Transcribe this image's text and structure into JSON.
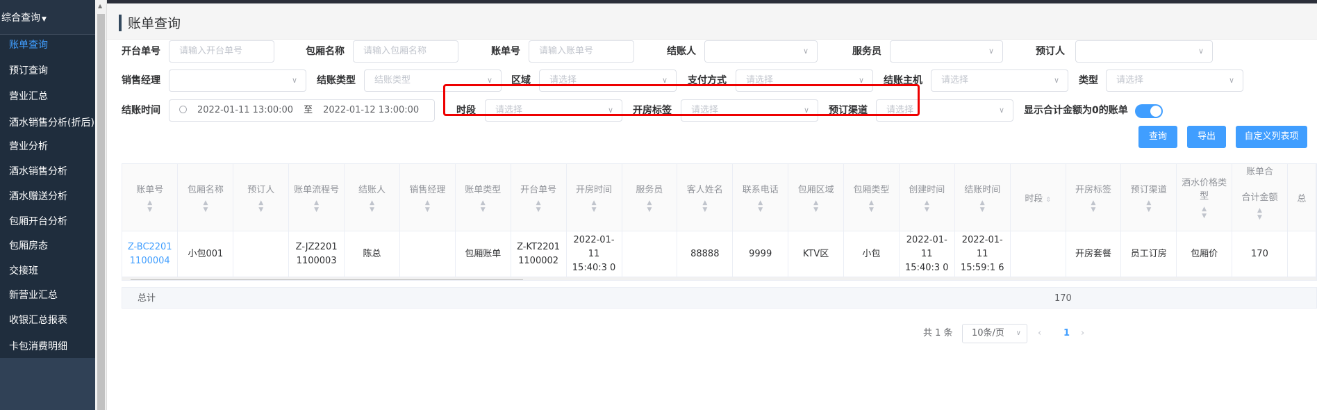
{
  "sidebar": {
    "group_label": "综合查询",
    "items": [
      {
        "label": "账单查询"
      },
      {
        "label": "预订查询"
      },
      {
        "label": "营业汇总"
      },
      {
        "label": "酒水销售分析(折后)"
      },
      {
        "label": "营业分析"
      },
      {
        "label": "酒水销售分析"
      },
      {
        "label": "酒水赠送分析"
      },
      {
        "label": "包厢开台分析"
      },
      {
        "label": "包厢房态"
      },
      {
        "label": "交接班"
      },
      {
        "label": "新营业汇总"
      },
      {
        "label": "收银汇总报表"
      },
      {
        "label": "卡包消费明细"
      }
    ]
  },
  "page": {
    "title": "账单查询"
  },
  "filters": {
    "open_order_no": {
      "label": "开台单号",
      "placeholder": "请输入开台单号"
    },
    "room_name": {
      "label": "包厢名称",
      "placeholder": "请输入包厢名称"
    },
    "bill_no": {
      "label": "账单号",
      "placeholder": "请输入账单号"
    },
    "checkout_person": {
      "label": "结账人",
      "value": ""
    },
    "waiter": {
      "label": "服务员",
      "value": ""
    },
    "booker": {
      "label": "预订人",
      "value": ""
    },
    "sales_manager": {
      "label": "销售经理",
      "value": ""
    },
    "checkout_type": {
      "label": "结账类型",
      "placeholder": "结账类型"
    },
    "area": {
      "label": "区域",
      "placeholder": "请选择"
    },
    "payment_method": {
      "label": "支付方式",
      "placeholder": "请选择"
    },
    "checkout_host": {
      "label": "结账主机",
      "placeholder": "请选择"
    },
    "type": {
      "label": "类型",
      "placeholder": "请选择"
    },
    "checkout_time": {
      "label": "结账时间",
      "start": "2022-01-11 13:00:00",
      "separator": "至",
      "end": "2022-01-12 13:00:00"
    },
    "time_slot": {
      "label": "时段",
      "placeholder": "请选择"
    },
    "room_tag": {
      "label": "开房标签",
      "placeholder": "请选择"
    },
    "booking_channel": {
      "label": "预订渠道",
      "placeholder": "请选择"
    },
    "show_zero": {
      "label": "显示合计金额为0的账单",
      "enabled": true
    }
  },
  "buttons": {
    "query": "查询",
    "export": "导出",
    "custom_columns": "自定义列表项"
  },
  "table": {
    "columns": [
      "账单号",
      "包厢名称",
      "预订人",
      "账单流程号",
      "结账人",
      "销售经理",
      "账单类型",
      "开台单号",
      "开房时间",
      "服务员",
      "客人姓名",
      "联系电话",
      "包厢区域",
      "包厢类型",
      "创建时间",
      "结账时间",
      "时段",
      "开房标签",
      "预订渠道",
      "酒水价格类型",
      "合计金额",
      "总"
    ],
    "group_header": "账单合",
    "rows": [
      [
        "Z-BC2201 1100004",
        "小包001",
        "",
        "Z-JZ2201 1100003",
        "陈总",
        "",
        "包厢账单",
        "Z-KT2201 1100002",
        "2022-01- 11 15:40:3 0",
        "",
        "88888",
        "9999",
        "KTV区",
        "小包",
        "2022-01- 11 15:40:3 0",
        "2022-01- 11 15:59:1 6",
        "",
        "开房套餐",
        "员工订房",
        "包厢价",
        "170",
        ""
      ]
    ],
    "total_label": "总计",
    "total_value": "170"
  },
  "pagination": {
    "total_text": "共 1 条",
    "page_size": "10条/页",
    "current_page": "1"
  },
  "colors": {
    "accent": "#409eff",
    "sidebar_bg": "#304156",
    "highlight": "#e00000"
  }
}
